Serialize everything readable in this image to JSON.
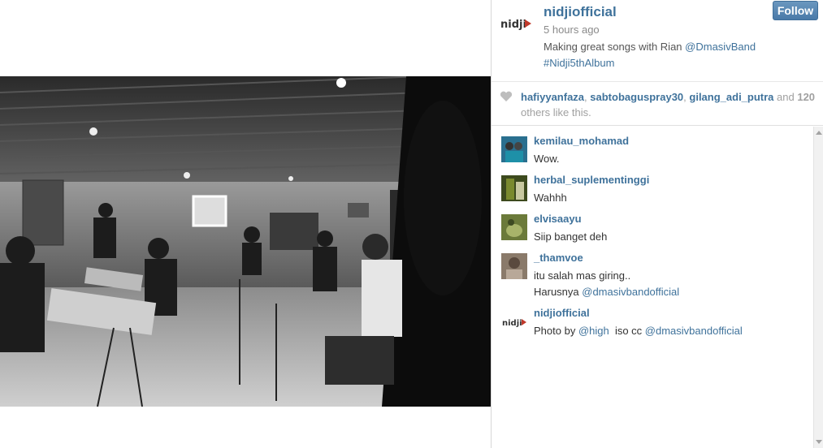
{
  "post": {
    "username": "nidjiofficial",
    "time": "5 hours ago",
    "caption_text": "Making great songs with Rian ",
    "caption_mention": "@DmasivBand",
    "caption_hashtag": "#Nidji5thAlbum",
    "follow_label": "Follow",
    "logo_text": "nidji"
  },
  "likes": {
    "user1": "hafiyyanfaza",
    "sep1": ", ",
    "user2": "sabtobaguspray30",
    "sep2": ", ",
    "user3": "gilang_adi_putra",
    "and": " and ",
    "count": "120",
    "others": " others like this."
  },
  "comments": [
    {
      "user": "kemilau_mohamad",
      "text": "Wow."
    },
    {
      "user": "herbal_suplementinggi",
      "text": "Wahhh"
    },
    {
      "user": "elvisaayu",
      "text": "Siip banget deh"
    },
    {
      "user": "_thamvoe",
      "text": "itu salah mas giring..",
      "text2_prefix": "Harusnya ",
      "text2_mention": "@dmasivbandofficial"
    },
    {
      "user": "nidjiofficial",
      "text_prefix": "Photo by ",
      "mention1": "@high",
      "mid": "  iso cc ",
      "mention2": "@dmasivbandofficial"
    }
  ],
  "colors": {
    "link": "#3f729b",
    "follow_bg": "#5585b2"
  }
}
